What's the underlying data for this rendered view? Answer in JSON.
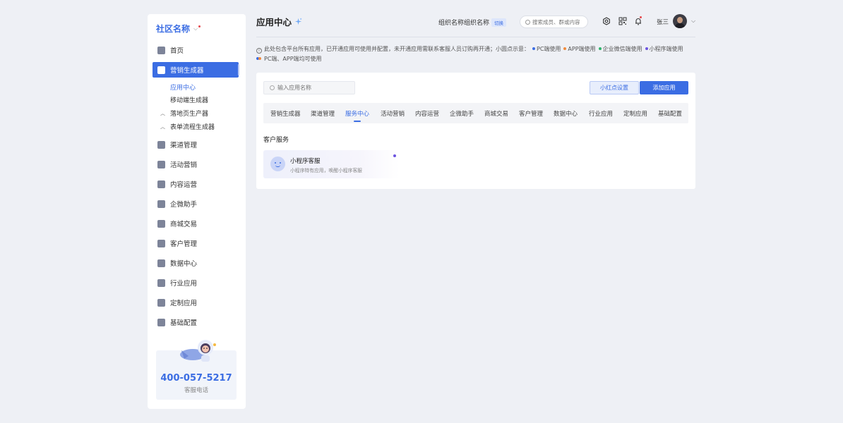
{
  "sidebar": {
    "brand": "社区名称",
    "items": [
      {
        "label": "首页"
      },
      {
        "label": "营销生成器"
      },
      {
        "label": "渠道管理"
      },
      {
        "label": "活动营销"
      },
      {
        "label": "内容运营"
      },
      {
        "label": "企微助手"
      },
      {
        "label": "商城交易"
      },
      {
        "label": "客户管理"
      },
      {
        "label": "数据中心"
      },
      {
        "label": "行业应用"
      },
      {
        "label": "定制应用"
      },
      {
        "label": "基础配置"
      }
    ],
    "sub_items": [
      {
        "label": "应用中心"
      },
      {
        "label": "移动端生成器"
      },
      {
        "label": "落地页生产器"
      },
      {
        "label": "表单流程生成器"
      }
    ],
    "promo": {
      "phone": "400-057-5217",
      "label": "客服电话"
    }
  },
  "header": {
    "title": "应用中心",
    "org_name": "组织名称组织名称",
    "switch_label": "切换",
    "search_placeholder": "搜索成员、群或内容",
    "user_name": "张三"
  },
  "notice": {
    "text": "此处包含平台所有应用，已开通应用可使用并配置，未开通应用需联系客服人员订购再开通；小圆点示意：",
    "legend": [
      {
        "label": "PC端使用",
        "color": "#3b6de3"
      },
      {
        "label": "APP端使用",
        "color": "#f08a3c"
      },
      {
        "label": "企业微信端使用",
        "color": "#2fb36b"
      },
      {
        "label": "小程序端使用",
        "color": "#6c54e0"
      }
    ],
    "dual_label": "PC端、APP端均可使用"
  },
  "main": {
    "search_placeholder": "输入应用名称",
    "btn_red_dot": "小红点设置",
    "btn_add": "添加应用",
    "tabs": [
      "营销生成器",
      "渠道管理",
      "服务中心",
      "活动营销",
      "内容运营",
      "企微助手",
      "商城交易",
      "客户管理",
      "数据中心",
      "行业应用",
      "定制应用",
      "基础配置"
    ],
    "active_tab": "服务中心",
    "section_title": "客户服务",
    "apps": [
      {
        "name": "小程序客服",
        "desc": "小程序特有应用，唤醒小程序客服"
      }
    ]
  }
}
